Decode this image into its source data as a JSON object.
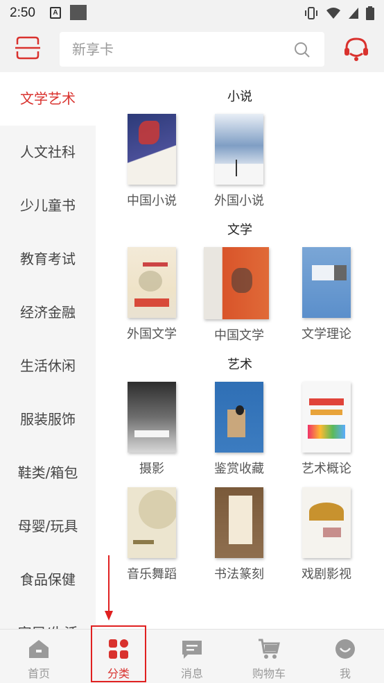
{
  "status_bar": {
    "time": "2:50",
    "notif_letter": "A"
  },
  "search": {
    "placeholder": "新享卡"
  },
  "sidebar": {
    "items": [
      {
        "label": "文学艺术"
      },
      {
        "label": "人文社科"
      },
      {
        "label": "少儿童书"
      },
      {
        "label": "教育考试"
      },
      {
        "label": "经济金融"
      },
      {
        "label": "生活休闲"
      },
      {
        "label": "服装服饰"
      },
      {
        "label": "鞋类/箱包"
      },
      {
        "label": "母婴/玩具"
      },
      {
        "label": "食品保健"
      },
      {
        "label": "家居/生活"
      }
    ]
  },
  "content": {
    "sections": [
      {
        "title": "小说",
        "books": [
          {
            "label": "中国小说"
          },
          {
            "label": "外国小说"
          }
        ]
      },
      {
        "title": "文学",
        "books": [
          {
            "label": "外国文学"
          },
          {
            "label": "中国文学"
          },
          {
            "label": "文学理论"
          }
        ]
      },
      {
        "title": "艺术",
        "books": [
          {
            "label": "摄影"
          },
          {
            "label": "鉴赏收藏"
          },
          {
            "label": "艺术概论"
          },
          {
            "label": "音乐舞蹈"
          },
          {
            "label": "书法篆刻"
          },
          {
            "label": "戏剧影视"
          }
        ]
      }
    ]
  },
  "tabbar": {
    "tabs": [
      {
        "label": "首页"
      },
      {
        "label": "分类"
      },
      {
        "label": "消息"
      },
      {
        "label": "购物车"
      },
      {
        "label": "我"
      }
    ]
  },
  "colors": {
    "accent": "#d9322e",
    "inactive": "#999999"
  }
}
